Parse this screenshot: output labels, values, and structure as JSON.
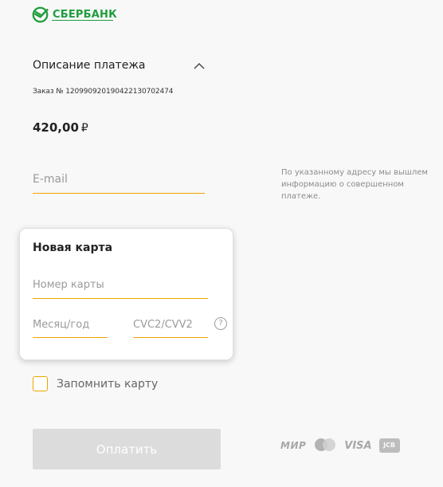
{
  "brand": {
    "name": "СБЕРБАНК",
    "color": "#1f9d3c"
  },
  "payment_description": {
    "title": "Описание платежа",
    "toggle_icon": "chevron-up-icon",
    "order": "Заказ № 12099092019042213070247​4",
    "amount": "420,00",
    "currency": "₽"
  },
  "email": {
    "placeholder": "E-mail",
    "value": "",
    "hint": "По указанному адресу мы вышлем информацию о совершенном платеже."
  },
  "card_form": {
    "title": "Новая карта",
    "number_placeholder": "Номер карты",
    "expiry_placeholder": "Месяц/год",
    "cvc_placeholder": "CVC2/CVV2",
    "help_icon": "question-icon",
    "help_symbol": "?"
  },
  "remember": {
    "label": "Запомнить карту",
    "checked": false
  },
  "pay_button": {
    "label": "Оплатить"
  },
  "payment_systems": {
    "mir": "МИР",
    "mastercard": "mastercard",
    "visa": "VISA",
    "jcb": "JCB"
  },
  "colors": {
    "accent": "#f0a400",
    "button_disabled": "#dcdcdc",
    "background": "#f8f8f8"
  }
}
